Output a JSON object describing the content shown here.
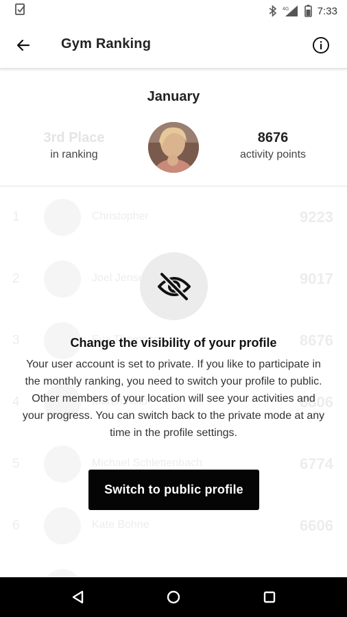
{
  "status_bar": {
    "time": "7:33",
    "network_label": "4G"
  },
  "app_bar": {
    "title": "Gym Ranking"
  },
  "summary": {
    "month": "January",
    "place_value": "3rd Place",
    "place_label": "in ranking",
    "points_value": "8676",
    "points_label": "activity points"
  },
  "ranking": {
    "rows": [
      {
        "rank": "1",
        "name": "Christopher",
        "points": "9223"
      },
      {
        "rank": "2",
        "name": "Joel Jensen",
        "points": "9017"
      },
      {
        "rank": "3",
        "name": "Eva Thompson",
        "points": "8676"
      },
      {
        "rank": "4",
        "name": "Martin Kolb",
        "points": "6806"
      },
      {
        "rank": "5",
        "name": "Michael Schlettenbach",
        "points": "6774"
      },
      {
        "rank": "6",
        "name": "Kate Bohne",
        "points": "6606"
      }
    ]
  },
  "visibility_prompt": {
    "title": "Change the visibility of your profile",
    "body": "Your user account is set to private. If you like to participate in the monthly ranking, you need to switch your profile to public. Other members of your location will see your activities and your progress. You can switch back to the private mode at any time in the profile settings.",
    "button_label": "Switch to public profile"
  },
  "icons": {
    "status_left": "checklist-icon",
    "bluetooth": "bluetooth-icon",
    "signal": "signal-icon",
    "battery": "battery-icon",
    "back": "arrow-left-icon",
    "info": "info-icon",
    "visibility": "eye-off-icon",
    "nav_back": "triangle-back-icon",
    "nav_home": "circle-home-icon",
    "nav_recents": "square-recents-icon"
  },
  "colors": {
    "primary_button": "#050505",
    "nav_bar": "#000000",
    "eye_circle": "#ececec"
  }
}
